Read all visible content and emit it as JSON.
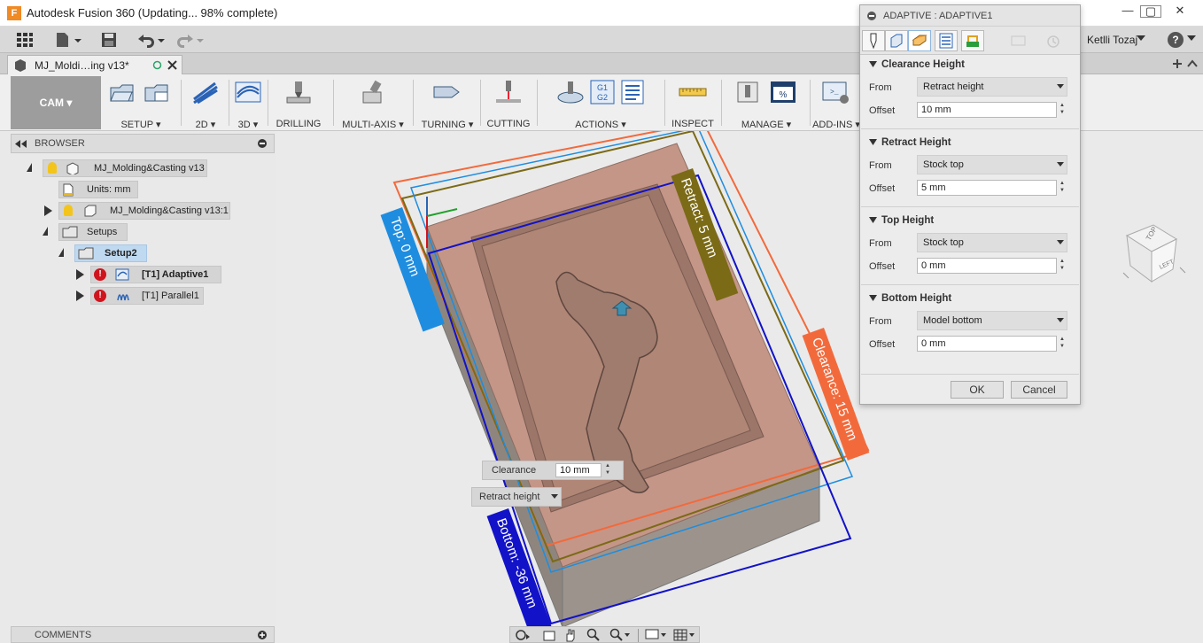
{
  "window": {
    "app_logo_letter": "F",
    "title": "Autodesk Fusion 360  (Updating... 98% complete)",
    "minimize": "—",
    "maximize": "▢",
    "close": "✕"
  },
  "toolbar": {
    "user_name": "Ketlli Tozaj",
    "help": "?"
  },
  "document": {
    "tab_label": "MJ_Moldi…ing v13*"
  },
  "ribbon": {
    "workspace": "CAM",
    "groups": [
      {
        "label": "SETUP ▾"
      },
      {
        "label": "2D ▾"
      },
      {
        "label": "3D ▾"
      },
      {
        "label": "DRILLING"
      },
      {
        "label": "MULTI-AXIS ▾"
      },
      {
        "label": "TURNING ▾"
      },
      {
        "label": "CUTTING"
      },
      {
        "label": "ACTIONS ▾"
      },
      {
        "label": "INSPECT"
      },
      {
        "label": "MANAGE ▾"
      },
      {
        "label": "ADD-INS ▾"
      }
    ],
    "actions_g_label": "G1\nG2"
  },
  "browser": {
    "title": "BROWSER",
    "root": "MJ_Molding&Casting v13",
    "units": "Units: mm",
    "component": "MJ_Molding&Casting v13:1",
    "setups": "Setups",
    "setup2": "Setup2",
    "op1": "[T1] Adaptive1",
    "op2": "[T1] Parallel1"
  },
  "comments": {
    "title": "COMMENTS"
  },
  "viewport": {
    "label_retract": "Retract: 5 mm",
    "label_top": "Top: 0 mm",
    "label_clearance": "Clearance: 15 mm",
    "label_bottom": "Bottom: -36 mm",
    "viewcube_top": "TOP",
    "viewcube_left": "LEFT",
    "inline_clearance_label": "Clearance",
    "inline_clearance_value": "10 mm",
    "inline_retract_select": "Retract height"
  },
  "dialog": {
    "title": "ADAPTIVE : ADAPTIVE1",
    "sections": [
      {
        "title": "Clearance Height",
        "from_label": "From",
        "from_value": "Retract height",
        "offset_label": "Offset",
        "offset_value": "10 mm"
      },
      {
        "title": "Retract Height",
        "from_label": "From",
        "from_value": "Stock top",
        "offset_label": "Offset",
        "offset_value": "5 mm"
      },
      {
        "title": "Top Height",
        "from_label": "From",
        "from_value": "Stock top",
        "offset_label": "Offset",
        "offset_value": "0 mm"
      },
      {
        "title": "Bottom Height",
        "from_label": "From",
        "from_value": "Model bottom",
        "offset_label": "Offset",
        "offset_value": "0 mm"
      }
    ],
    "ok": "OK",
    "cancel": "Cancel"
  },
  "colors": {
    "clearance": "#f26a3c",
    "retract": "#7b6a16",
    "top": "#1e8de0",
    "bottom": "#1212c8",
    "model": "#c7a095"
  }
}
